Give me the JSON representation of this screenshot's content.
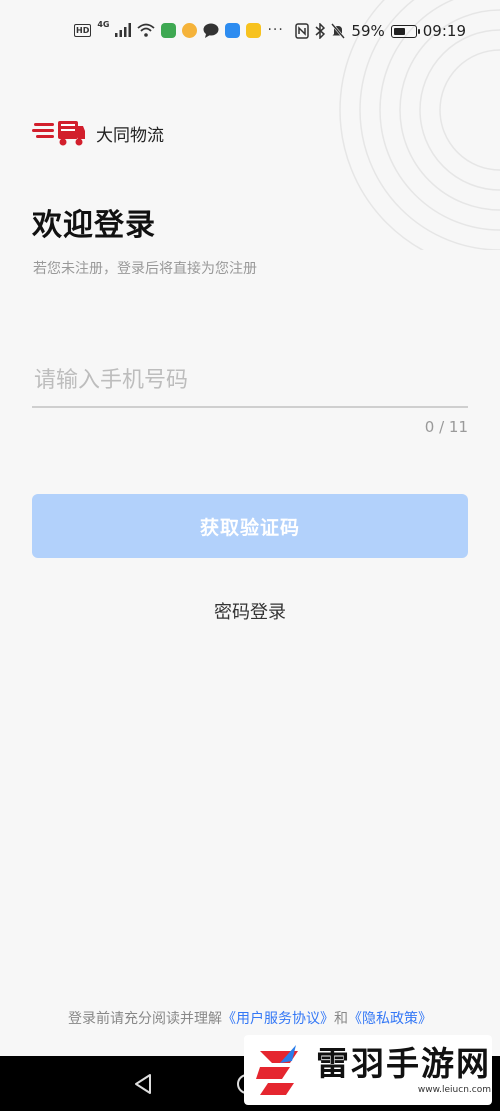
{
  "status_bar": {
    "left_badges": [
      "HD",
      "4G"
    ],
    "battery_percent": "59%",
    "battery_level": 0.59,
    "time": "09:19",
    "more": "···"
  },
  "brand": {
    "name": "大同物流",
    "logo_color": "#d21f2c"
  },
  "login": {
    "title": "欢迎登录",
    "subtitle": "若您未注册，登录后将直接为您注册",
    "phone_placeholder": "请输入手机号码",
    "phone_value": "",
    "counter": "0 / 11",
    "get_code_label": "获取验证码",
    "password_login_label": "密码登录"
  },
  "agreement": {
    "prefix": "登录前请充分阅读并理解",
    "user_agreement": "《用户服务协议》",
    "and": "和",
    "privacy_policy": "《隐私政策》"
  },
  "watermark": {
    "text": "雷羽手游网",
    "url": "www.leiucn.com"
  },
  "colors": {
    "accent": "#3478f6",
    "button_disabled": "#b2d1fb",
    "brand_red": "#d21f2c"
  }
}
